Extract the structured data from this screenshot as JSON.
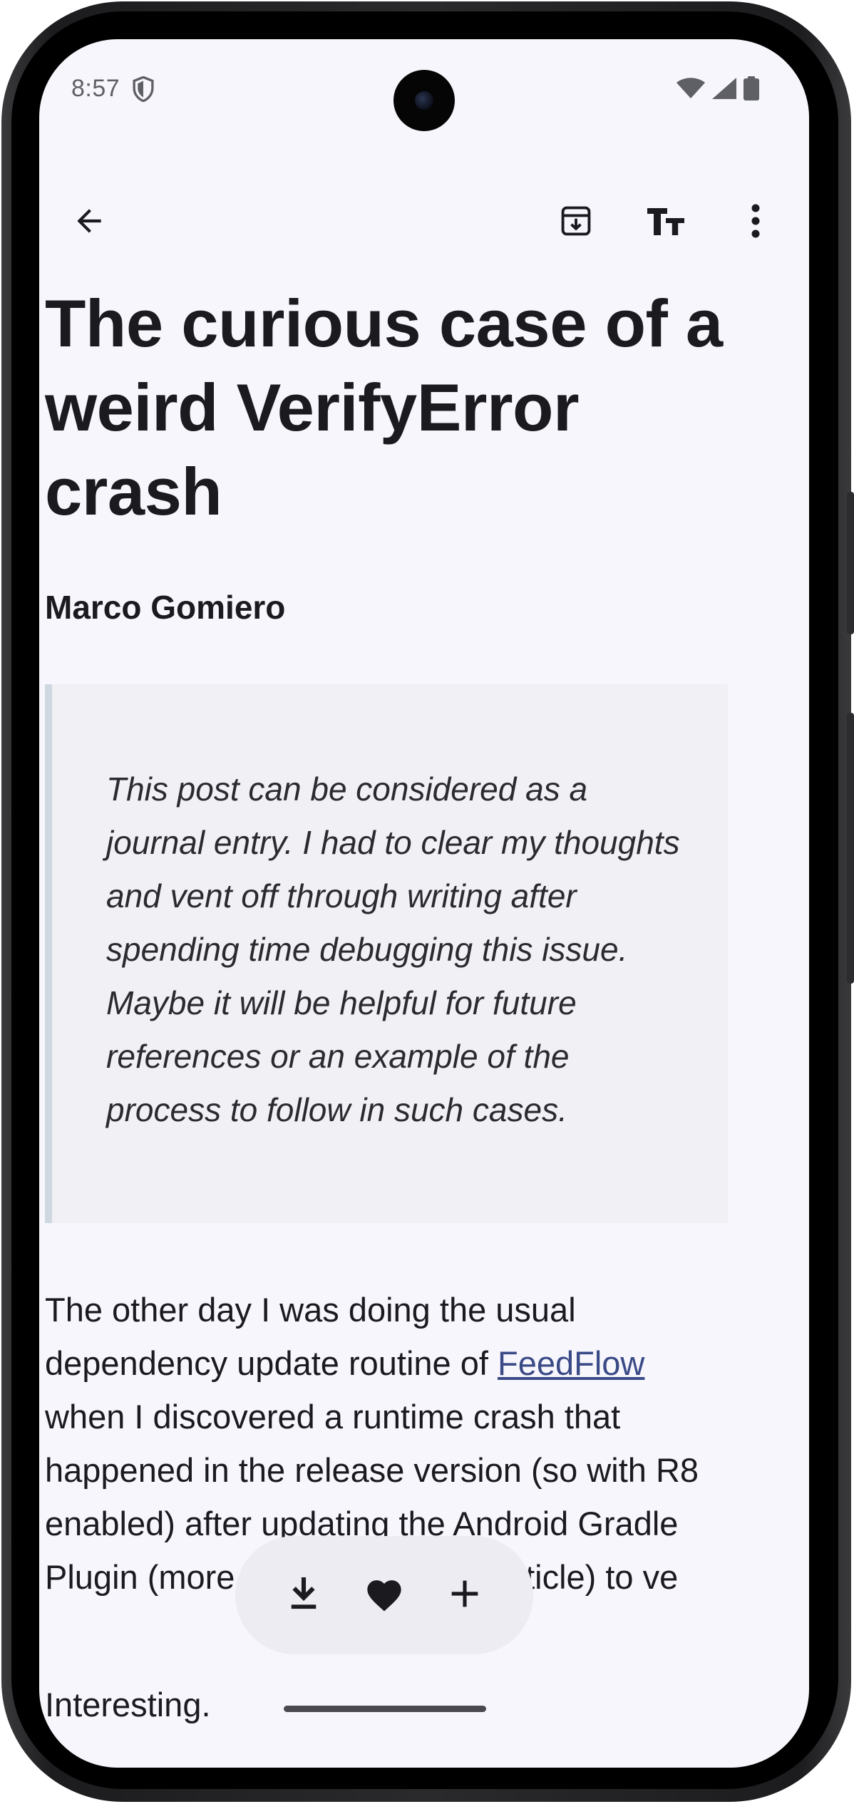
{
  "status_bar": {
    "time": "8:57",
    "icons": [
      "shield-icon",
      "wifi-icon",
      "signal-icon",
      "battery-icon"
    ]
  },
  "app_bar": {
    "back_icon": "arrow-left-icon",
    "actions": [
      "archive-download-icon",
      "text-size-icon",
      "more-vert-icon"
    ]
  },
  "article": {
    "title": "The curious case of a weird VerifyError crash",
    "author": "Marco Gomiero",
    "quote": "This post can be considered as a journal entry. I had to clear my thoughts and vent off through writing after spending time debugging this issue. Maybe it will be helpful for future references or an example of the process to follow in such cases.",
    "paragraph1_before_link": "The other day I was doing the usual dependency update routine of ",
    "paragraph1_link": "FeedFlow",
    "paragraph1_after_link": " when I discovered a runtime crash that happened in the release version (so with R8 enabled) after updating the Android Gradle Plugin (more at the end of the article) to ve",
    "paragraph2": "Interesting."
  },
  "bottom_toolbar": {
    "actions": [
      "download-icon",
      "heart-icon",
      "plus-icon"
    ]
  },
  "colors": {
    "background": "#f7f6fd",
    "text": "#1b1b1f",
    "link": "#3a4a86",
    "quote_bg": "#f0f0f5",
    "quote_border": "#cfd8e0"
  }
}
